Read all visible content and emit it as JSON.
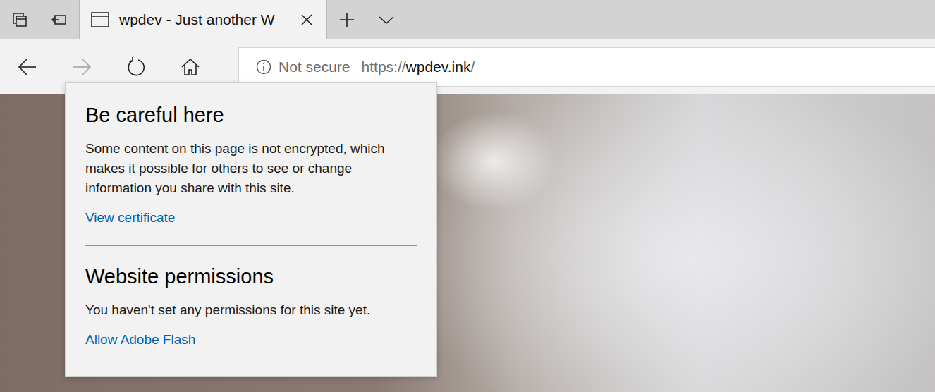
{
  "window": {
    "tabs": [
      {
        "title": "wpdev - Just another W",
        "selected": true
      }
    ]
  },
  "toolbar": {
    "nav_buttons": [
      {
        "kind": "back",
        "disabled": false
      },
      {
        "kind": "forward",
        "disabled": true
      },
      {
        "kind": "refresh",
        "disabled": false
      },
      {
        "kind": "home",
        "disabled": false
      }
    ]
  },
  "address_bar": {
    "security_label": "Not secure",
    "url_scheme": "https://",
    "url_host": "wpdev.ink",
    "url_path": "/"
  },
  "popup": {
    "title": "Be careful here",
    "message": "Some content on this page is not encrypted, which makes it possible for others to see or change information you share with this site.",
    "link": "View certificate",
    "section_title": "Website permissions",
    "section_text": "You haven't set any permissions for this site yet.",
    "section_link": "Allow Adobe Flash"
  }
}
